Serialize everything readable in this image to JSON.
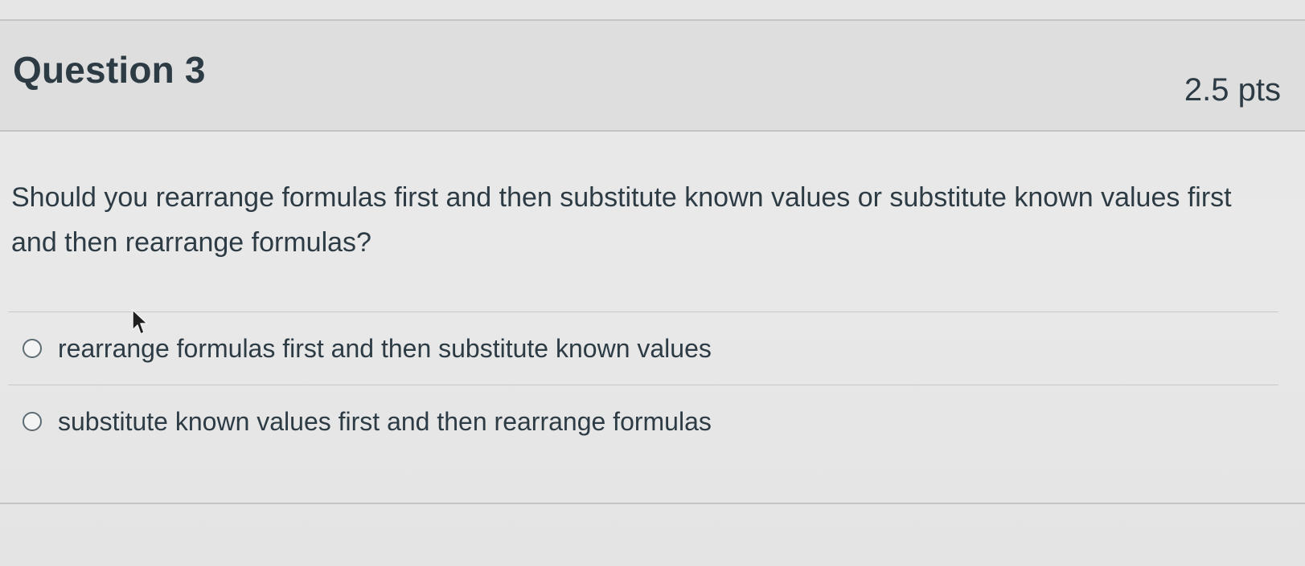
{
  "question": {
    "title": "Question 3",
    "points": "2.5 pts",
    "text": "Should you rearrange formulas first and then substitute known values or substitute known values first and then rearrange formulas?"
  },
  "answers": [
    {
      "label": "rearrange formulas first and then substitute known values",
      "selected": false
    },
    {
      "label": "substitute known values first and then rearrange formulas",
      "selected": false
    }
  ],
  "icons": {
    "cursor": "mouse-pointer-icon",
    "radio": "radio-button-icon"
  },
  "colors": {
    "text": "#2d3b45",
    "header_bg": "#dedede",
    "page_bg": "#e7e7e7",
    "divider": "#c9c9c9"
  }
}
